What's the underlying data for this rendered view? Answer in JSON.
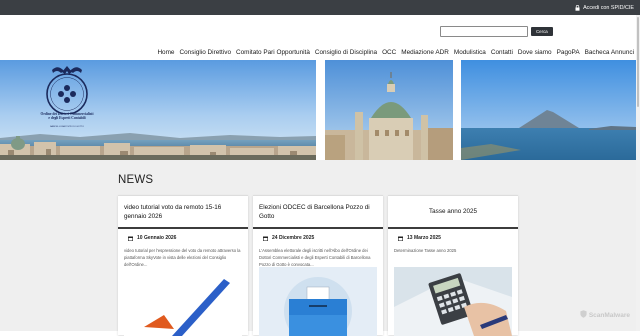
{
  "topbar": {
    "login_label": "Accedi con SPID/CIE"
  },
  "search": {
    "placeholder": "",
    "button_label": "Cerca"
  },
  "nav": [
    "Home",
    "Consiglio Direttivo",
    "Comitato Pari Opportunità",
    "Consiglio di Disciplina",
    "OCC",
    "Mediazione ADR",
    "Modulistica",
    "Contatti",
    "Dove siamo",
    "PagoPA",
    "Bacheca Annunci"
  ],
  "logo": {
    "line1": "Ordine dei Dottori Commercialisti",
    "line2": "e degli Esperti Contabili",
    "line3": "BARCELLONA POZZO DI GOTTO"
  },
  "news": {
    "heading": "NEWS",
    "cards": [
      {
        "title": "video tutorial voto da remoto 15-16 gennaio 2026",
        "date": "10 Gennaio 2026",
        "desc": "video tutorial per l'espressione del voto da remoto attraverso la piattaforma SkyVote in vista delle elezioni del Consiglio dell'Ordine..."
      },
      {
        "title": "Elezioni ODCEC di Barcellona Pozzo di Gotto",
        "date": "24 Dicembre 2025",
        "desc": "L'Assemblea elettorale degli iscritti nell'Albo dell'Ordine dei Dottori Commercialisti e degli Esperti Contabili di Barcellona Pozzo di Gotto è convocata..."
      },
      {
        "title": "Tasse anno 2025",
        "date": "13 Marzo 2025",
        "desc": "Determinazione Tasse anno 2025"
      }
    ]
  },
  "watermark": "ScanMalware",
  "colors": {
    "topbar": "#3b3f44",
    "news_bg": "#efefef",
    "logo_blue": "#1b2a5c"
  }
}
